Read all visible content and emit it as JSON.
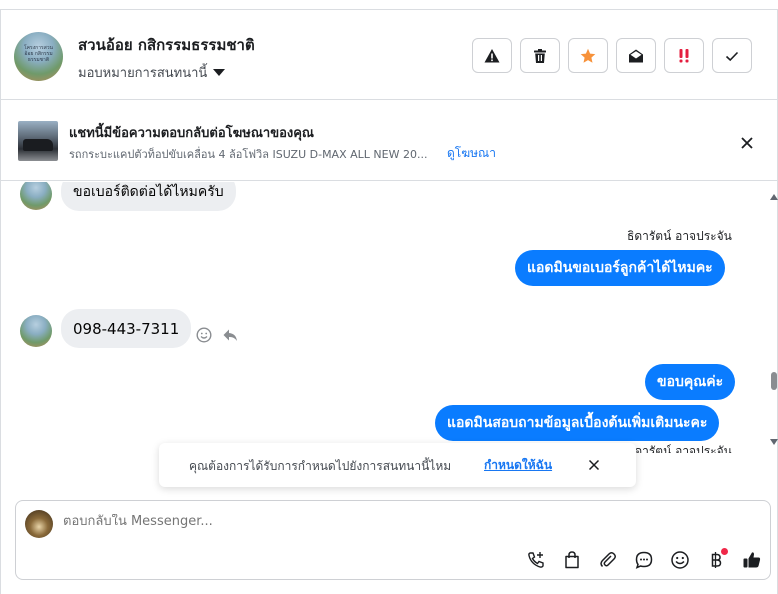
{
  "header": {
    "contact_name": "สวนอ้อย กสิกรรมธรรมชาติ",
    "avatar_text": "โครงการสวนอ้อย กสิกรรมธรรมชาติ",
    "assign_label": "มอบหมายการสนทนานี้",
    "actions": [
      {
        "name": "spam-button",
        "icon": "warning-icon"
      },
      {
        "name": "delete-button",
        "icon": "trash-icon"
      },
      {
        "name": "star-button",
        "icon": "star-icon"
      },
      {
        "name": "mark-unread-button",
        "icon": "envelope-open-icon"
      },
      {
        "name": "follow-up-button",
        "icon": "exclamation-icon"
      },
      {
        "name": "done-button",
        "icon": "check-icon"
      }
    ]
  },
  "ad_banner": {
    "title": "แชทนี้มีข้อความตอบกลับต่อโฆษณาของคุณ",
    "subtitle": "รถกระบะแคปตัวท็อปขับเคลื่อน 4 ล้อโฟวิล ISUZU D-MAX ALL NEW 20...",
    "link": "ดูโฆษณา"
  },
  "messages": [
    {
      "direction": "in",
      "text": "ขอเบอร์ติดต่อได้ไหมครับ"
    },
    {
      "direction": "out",
      "sender": "ธิดารัตน์ อาจประจัน",
      "text": "แอดมินขอเบอร์ลูกค้าได้ไหมคะ"
    },
    {
      "direction": "in",
      "text": "098-443-7311"
    },
    {
      "direction": "out",
      "text": "ขอบคุณค่ะ"
    },
    {
      "direction": "out",
      "sender": "ธิดารัตน์ อาจประจัน",
      "text": "แอดมินสอบถามข้อมูลเบื้องต้นเพิ่มเติมนะคะ"
    }
  ],
  "toast": {
    "text": "คุณต้องการได้รับการกำหนดไปยังการสนทนานี้ไหม",
    "link": "กำหนดให้ฉัน"
  },
  "composer": {
    "placeholder": "ตอบกลับใน Messenger...",
    "tools": [
      "call-icon",
      "bag-icon",
      "paperclip-icon",
      "chat-bubble-icon",
      "emoji-icon",
      "baht-icon",
      "thumbs-up-icon"
    ]
  },
  "colors": {
    "outgoing_bubble": "#0a7cff",
    "incoming_bubble": "#eceef1",
    "link": "#1877f2",
    "star": "#f7923b",
    "alert": "#e41e3f"
  }
}
